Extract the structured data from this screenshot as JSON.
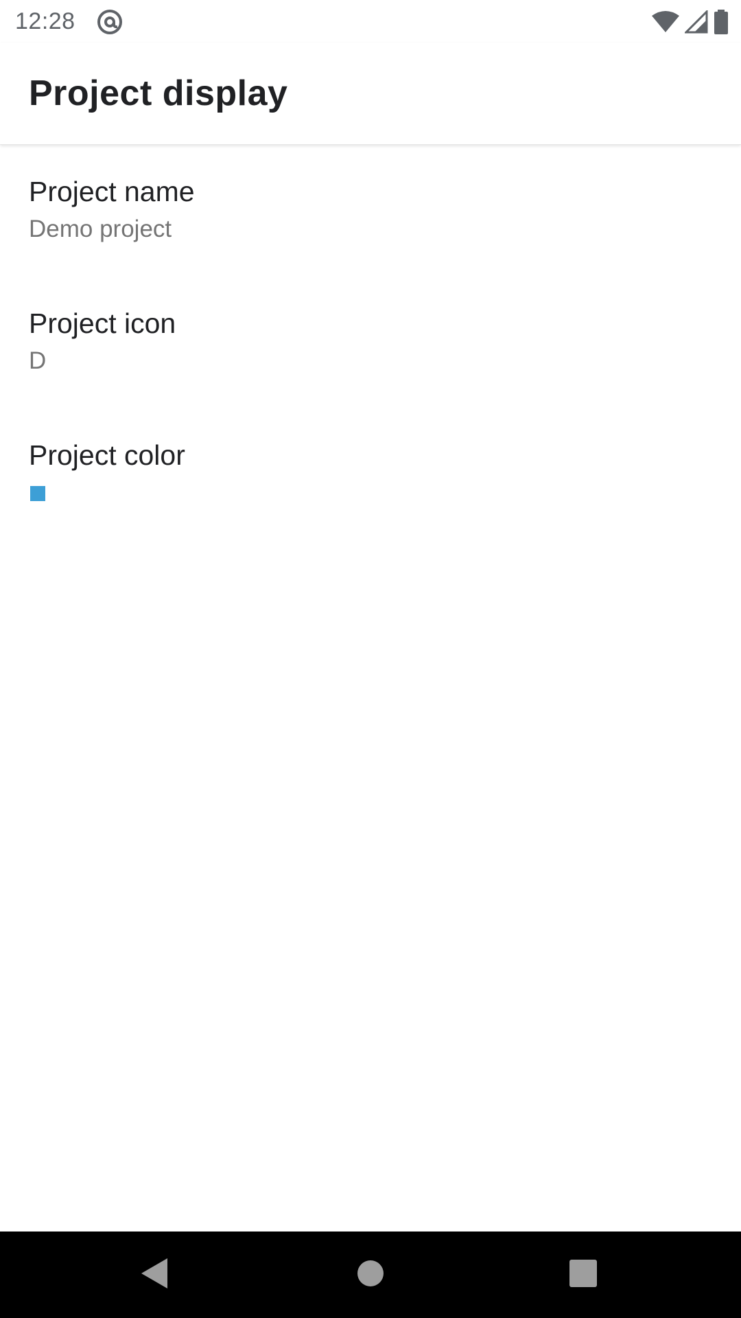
{
  "status_bar": {
    "time": "12:28",
    "notification_icon": "at-sign-icon",
    "wifi_icon": "wifi-icon",
    "signal_icon": "cell-signal-icon",
    "battery_icon": "battery-icon"
  },
  "app_bar": {
    "title": "Project display"
  },
  "preferences": [
    {
      "title": "Project name",
      "summary": "Demo project"
    },
    {
      "title": "Project icon",
      "summary": "D"
    },
    {
      "title": "Project color",
      "summary_color": "#3d9fd6"
    }
  ],
  "nav_bar": {
    "back_icon": "back-triangle-icon",
    "home_icon": "home-circle-icon",
    "recents_icon": "recents-square-icon"
  }
}
